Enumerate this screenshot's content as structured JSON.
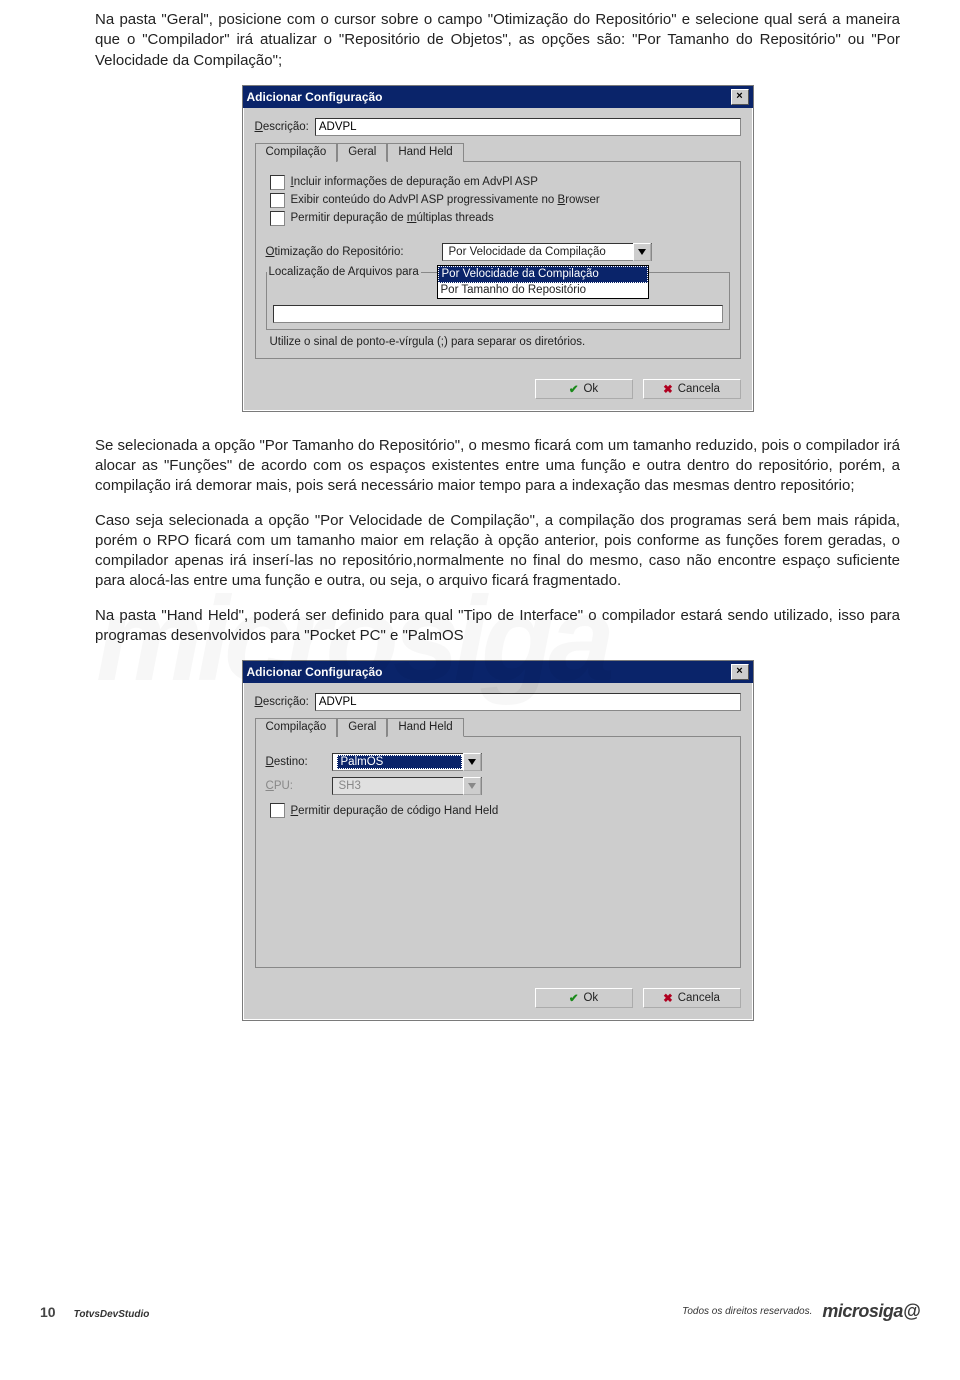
{
  "para1": "Na pasta \"Geral\", posicione com o cursor sobre o campo \"Otimização do Repositório\" e selecione qual será a maneira que o \"Compilador\" irá atualizar o \"Repositório de Objetos\", as opções são: \"Por Tamanho do Repositório\" ou \"Por Velocidade da Compilação\";",
  "para2": "Se selecionada a opção \"Por Tamanho do Repositório\", o mesmo ficará com um tamanho reduzido, pois o compilador irá alocar as \"Funções\" de acordo com os espaços existentes entre uma função e outra dentro do repositório, porém, a compilação irá demorar mais, pois será necessário maior tempo para a indexação das mesmas dentro repositório;",
  "para3": "Caso seja selecionada a opção \"Por Velocidade de Compilação\", a compilação dos programas será bem mais rápida, porém o RPO ficará com um tamanho maior em relação à opção anterior, pois conforme as funções forem geradas, o compilador apenas irá inserí-las no repositório,normalmente no final do mesmo, caso não encontre espaço suficiente para alocá-las entre uma função e outra, ou seja, o arquivo ficará fragmentado.",
  "para4": "Na pasta \"Hand Held\", poderá ser definido para qual \"Tipo de Interface\" o compilador estará sendo utilizado, isso para programas desenvolvidos para \"Pocket PC\" e \"PalmOS",
  "dialog": {
    "title": "Adicionar Configuração",
    "descLabelPrefix": "D",
    "descLabelRest": "escrição:",
    "descValue": "ADVPL",
    "tabs": {
      "compilacao": "Compilação",
      "geral": "Geral",
      "handheld": "Hand Held"
    },
    "geral": {
      "chk1_pre": "I",
      "chk1": "ncluir informações de depuração em AdvPl ASP",
      "chk2": "Exibir conteúdo do AdvPl ASP progressivamente no ",
      "chk2_u": "B",
      "chk2_post": "rowser",
      "chk3": "Permitir depuração de ",
      "chk3_u": "m",
      "chk3_post": "últiplas threads",
      "optLabel_pre": "O",
      "optLabel": "timização do Repositório:",
      "optValue": "Por Velocidade da Compilação",
      "locLabel": "Localização de Arquivos para",
      "opt1": "Por Velocidade da Compilação",
      "opt2": "Por Tamanho do Repositório",
      "util": "Utilize o sinal de ponto-e-vírgula (;) para separar os diretórios."
    },
    "handheld": {
      "destLabel_pre": "D",
      "destLabel": "estino:",
      "destValue": "PalmOS",
      "cpuLabel_pre": "C",
      "cpuLabel": "PU:",
      "cpuValue": "SH3",
      "permit_pre": "P",
      "permit": "ermitir depuração de código Hand Held"
    },
    "okLabel": "Ok",
    "cancelLabel": "Cancela"
  },
  "footer": {
    "page": "10",
    "filename": "TotvsDevStudio",
    "rights": "Todos os direitos reservados.",
    "brand": "microsiga"
  },
  "watermark": "microsiga"
}
